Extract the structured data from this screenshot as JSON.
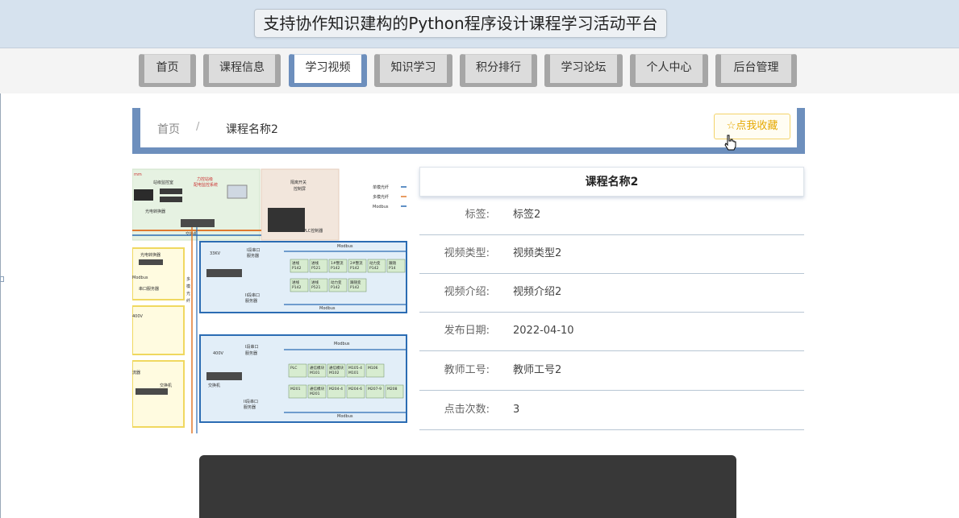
{
  "site": {
    "title": "支持协作知识建构的Python程序设计课程学习活动平台"
  },
  "nav": {
    "items": [
      {
        "label": "首页"
      },
      {
        "label": "课程信息"
      },
      {
        "label": "学习视频"
      },
      {
        "label": "知识学习"
      },
      {
        "label": "积分排行"
      },
      {
        "label": "学习论坛"
      },
      {
        "label": "个人中心"
      },
      {
        "label": "后台管理"
      }
    ],
    "active": "学习视频"
  },
  "breadcrumb": {
    "home": "首页",
    "separator": "/",
    "current": "课程名称2"
  },
  "favorite": {
    "label": "☆点我收藏",
    "color": "#e5a800"
  },
  "course": {
    "title": "课程名称2",
    "fields": [
      {
        "label": "标签:",
        "value": "标签2"
      },
      {
        "label": "视频类型:",
        "value": "视频类型2"
      },
      {
        "label": "视频介绍:",
        "value": "视频介绍2"
      },
      {
        "label": "发布日期:",
        "value": "2022-04-10"
      },
      {
        "label": "教师工号:",
        "value": "教师工号2"
      },
      {
        "label": "点击次数:",
        "value": "3"
      }
    ]
  },
  "diagram": {
    "legend": [
      "单模光纤",
      "多模光纤",
      "Modbus"
    ],
    "labels": {
      "top_a": "站级监控室",
      "top_b": "力控站级",
      "top_b2": "配电监控系统",
      "top_c": "隔离开关",
      "top_c2": "控制屏",
      "converter": "光电转换器",
      "switch": "交换机",
      "plc": "PLC控制器",
      "kv33": "33KV",
      "serial1": "I段串口",
      "serial1b": "服务器",
      "serial2": "II段串口",
      "serial2b": "服务器",
      "modbus": "Modbus",
      "conv2": "光电转换器",
      "serial": "串口服务器",
      "modbus_left": "Modbus",
      "fiber": "多",
      "fiber2": "模",
      "fiber3": "光",
      "fiber4": "纤",
      "v400a": "400V",
      "v400": "400V",
      "server": "流器",
      "switch2": "交换机",
      "mm": "mm",
      "cells1": [
        "进线",
        "进线",
        "1#整流",
        "2#整流",
        "动力变",
        "跟随"
      ],
      "cells1b": [
        "P142",
        "P521",
        "P142",
        "P142",
        "P142",
        "P14"
      ],
      "cells2": [
        "进线",
        "进线",
        "动力变",
        "跟随变"
      ],
      "cells2b": [
        "P142",
        "P521",
        "P142",
        "P142"
      ],
      "cells3": [
        "PLC",
        "通信模块",
        "通信模块",
        "M105-4",
        "M106"
      ],
      "cells3b": [
        "",
        "M101",
        "M102",
        "M101",
        ""
      ],
      "cells4": [
        "M201",
        "通信模块",
        "M204-4",
        "M204-6",
        "M207-9",
        "M208"
      ],
      "cells4b": [
        "",
        "M201",
        "",
        "",
        "",
        ""
      ]
    }
  }
}
